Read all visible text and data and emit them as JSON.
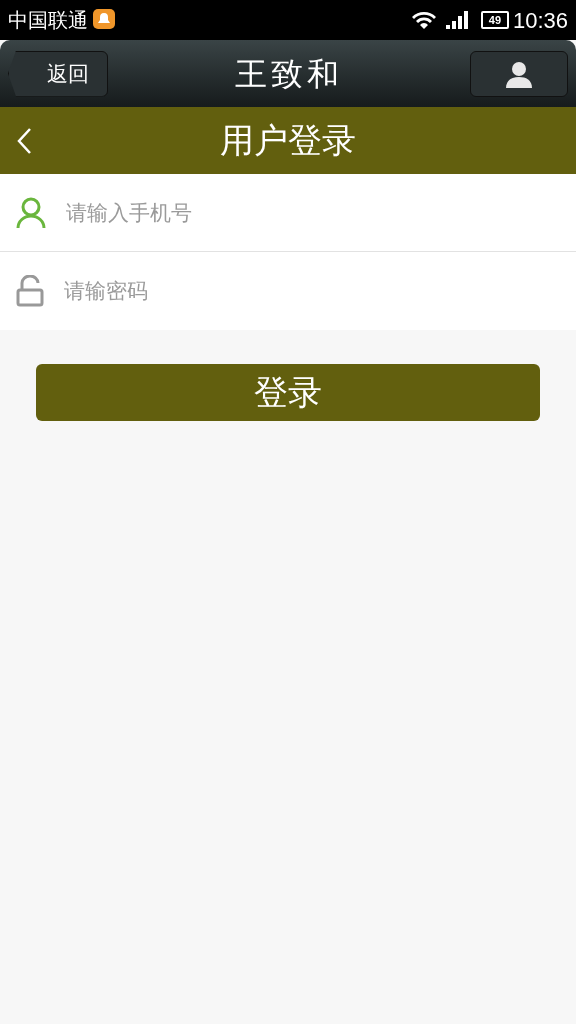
{
  "status_bar": {
    "carrier": "中国联通",
    "battery": "49",
    "time": "10:36"
  },
  "nav_bar": {
    "back_label": "返回",
    "title": "王致和"
  },
  "page_header": {
    "title": "用户登录"
  },
  "fields": [
    {
      "kind": "phone",
      "placeholder": "请输入手机号"
    },
    {
      "kind": "password",
      "placeholder": "请输密码"
    }
  ],
  "login_button": "登录"
}
